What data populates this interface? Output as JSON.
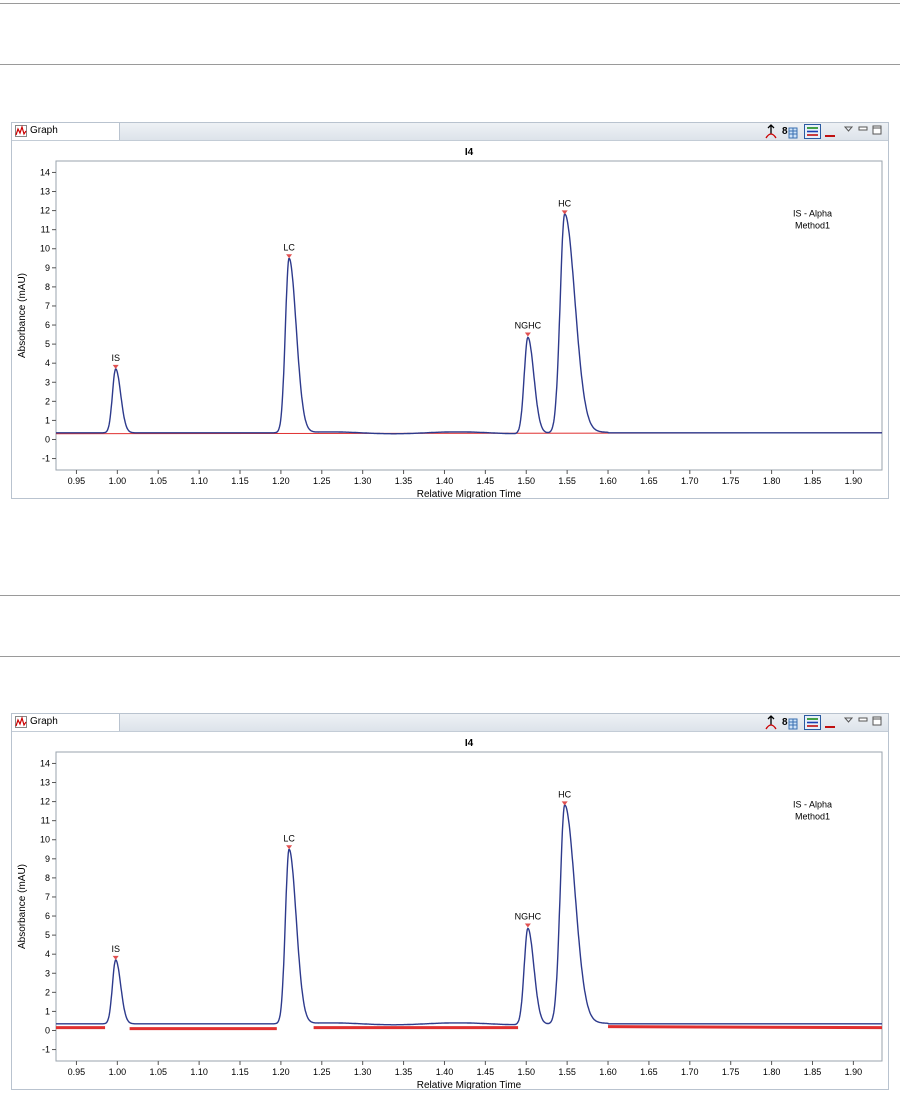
{
  "panels": [
    {
      "tab_label": "Graph",
      "chart_data": {
        "type": "line",
        "title": "I4",
        "xlabel": "Relative Migration Time",
        "ylabel": "Absorbance (mAU)",
        "xlim": [
          0.925,
          1.935
        ],
        "ylim": [
          -1.6,
          14.6
        ],
        "x_ticks": [
          "0.95",
          "1.00",
          "1.05",
          "1.10",
          "1.15",
          "1.20",
          "1.25",
          "1.30",
          "1.35",
          "1.40",
          "1.45",
          "1.50",
          "1.55",
          "1.60",
          "1.65",
          "1.70",
          "1.75",
          "1.80",
          "1.85",
          "1.90"
        ],
        "y_ticks": [
          "-1",
          "0",
          "1",
          "2",
          "3",
          "4",
          "5",
          "6",
          "7",
          "8",
          "9",
          "10",
          "11",
          "12",
          "13",
          "14"
        ],
        "annotation": [
          "IS - Alpha",
          "Method1"
        ],
        "series": [
          {
            "color": "#2d3a8c",
            "baseline": 0.35,
            "peaks": [
              {
                "label": "IS",
                "x": 0.998,
                "y": 3.7,
                "w": 0.004,
                "rise": 0.006
              },
              {
                "label": "LC",
                "x": 1.21,
                "y": 9.5,
                "w": 0.0045,
                "rise": 0.012
              },
              {
                "label": "NGHC",
                "x": 1.502,
                "y": 5.4,
                "w": 0.0045,
                "rise": 0.008
              },
              {
                "label": "HC",
                "x": 1.547,
                "y": 11.8,
                "w": 0.0055,
                "rise": 0.02
              }
            ]
          }
        ],
        "baselines": [
          {
            "x": [
              0.925,
              1.935
            ],
            "y": [
              0.3,
              0.35
            ],
            "color": "#e03030",
            "thick": false
          }
        ]
      }
    },
    {
      "tab_label": "Graph",
      "chart_data": {
        "type": "line",
        "title": "I4",
        "xlabel": "Relative Migration Time",
        "ylabel": "Absorbance (mAU)",
        "xlim": [
          0.925,
          1.935
        ],
        "ylim": [
          -1.6,
          14.6
        ],
        "x_ticks": [
          "0.95",
          "1.00",
          "1.05",
          "1.10",
          "1.15",
          "1.20",
          "1.25",
          "1.30",
          "1.35",
          "1.40",
          "1.45",
          "1.50",
          "1.55",
          "1.60",
          "1.65",
          "1.70",
          "1.75",
          "1.80",
          "1.85",
          "1.90"
        ],
        "y_ticks": [
          "-1",
          "0",
          "1",
          "2",
          "3",
          "4",
          "5",
          "6",
          "7",
          "8",
          "9",
          "10",
          "11",
          "12",
          "13",
          "14"
        ],
        "annotation": [
          "IS - Alpha",
          "Method1"
        ],
        "series": [
          {
            "color": "#2d3a8c",
            "baseline": 0.35,
            "peaks": [
              {
                "label": "IS",
                "x": 0.998,
                "y": 3.7,
                "w": 0.004,
                "rise": 0.006
              },
              {
                "label": "LC",
                "x": 1.21,
                "y": 9.5,
                "w": 0.0045,
                "rise": 0.012
              },
              {
                "label": "NGHC",
                "x": 1.502,
                "y": 5.4,
                "w": 0.0045,
                "rise": 0.008
              },
              {
                "label": "HC",
                "x": 1.547,
                "y": 11.8,
                "w": 0.0055,
                "rise": 0.02
              }
            ]
          }
        ],
        "baselines": [
          {
            "x": [
              0.925,
              0.985
            ],
            "y": [
              0.15,
              0.15
            ],
            "color": "#e03030",
            "thick": true
          },
          {
            "x": [
              1.015,
              1.195
            ],
            "y": [
              0.1,
              0.1
            ],
            "color": "#e03030",
            "thick": true
          },
          {
            "x": [
              1.24,
              1.49
            ],
            "y": [
              0.15,
              0.15
            ],
            "color": "#e03030",
            "thick": true
          },
          {
            "x": [
              1.6,
              1.935
            ],
            "y": [
              0.2,
              0.15
            ],
            "color": "#e03030",
            "thick": true
          }
        ]
      }
    }
  ]
}
